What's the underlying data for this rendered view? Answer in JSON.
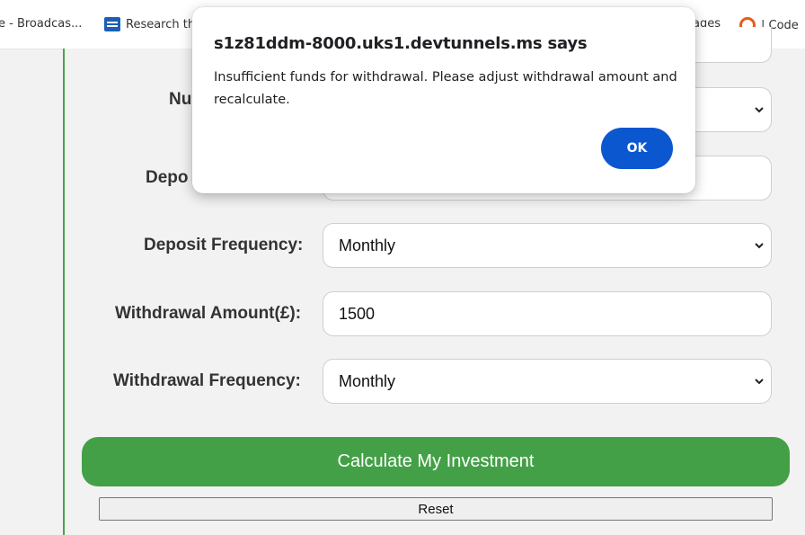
{
  "bookmarks": [
    {
      "label": "e - Broadcas...",
      "icon": "none"
    },
    {
      "label": "Research th",
      "icon": "document-icon"
    },
    {
      "label": "ages",
      "icon": "none"
    },
    {
      "label": "| Code",
      "icon": "ring-icon"
    }
  ],
  "form": {
    "fields": [
      {
        "label": "Nu",
        "value": "",
        "type": "select"
      },
      {
        "label": "Depo",
        "value": "",
        "type": "input"
      },
      {
        "label": "Deposit Frequency:",
        "value": "Monthly",
        "type": "select"
      },
      {
        "label": "Withdrawal Amount(£):",
        "value": "1500",
        "type": "input"
      },
      {
        "label": "Withdrawal Frequency:",
        "value": "Monthly",
        "type": "select"
      }
    ],
    "calculate_label": "Calculate My Investment",
    "reset_label": "Reset"
  },
  "dialog": {
    "title": "s1z81ddm-8000.uks1.devtunnels.ms says",
    "message": "Insufficient funds for withdrawal. Please adjust withdrawal amount and recalculate.",
    "ok_label": "OK"
  },
  "colors": {
    "accent_green": "#43a047",
    "ok_blue": "#0b57d0"
  }
}
